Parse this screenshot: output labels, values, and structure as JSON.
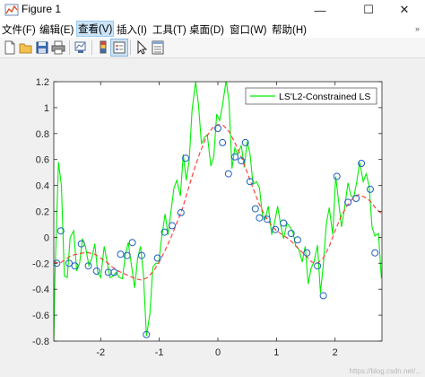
{
  "window": {
    "title": "Figure 1",
    "minimize": "—",
    "maximize": "☐",
    "close": "✕"
  },
  "menu": {
    "items": [
      "文件(F)",
      "编辑(E)",
      "查看(V)",
      "插入(I)",
      "工具(T)",
      "桌面(D)",
      "窗口(W)",
      "帮助(H)"
    ],
    "active_index": 2,
    "overflow": "»"
  },
  "toolbar": {
    "buttons": [
      "new-figure-icon",
      "open-file-icon",
      "save-icon",
      "print-icon",
      "link-plot-icon",
      "insert-colorbar-icon",
      "insert-legend-icon",
      "edit-plot-icon",
      "property-inspector-icon"
    ]
  },
  "watermark": "https://blog.csdn.net/...",
  "chart_data": {
    "type": "line",
    "xlim": [
      -2.8,
      2.8
    ],
    "ylim": [
      -0.8,
      1.2
    ],
    "xticks": [
      -2,
      -1,
      0,
      1,
      2
    ],
    "yticks": [
      -0.8,
      -0.6,
      -0.4,
      -0.2,
      0,
      0.2,
      0.4,
      0.6,
      0.8,
      1,
      1.2
    ],
    "xtick_labels": [
      "-2",
      "-1",
      "0",
      "1",
      "2"
    ],
    "ytick_labels": [
      "-0.8",
      "-0.6",
      "-0.4",
      "-0.2",
      "0",
      "0.2",
      "0.4",
      "0.6",
      "0.8",
      "1",
      "1.2"
    ],
    "grid": false,
    "legend": {
      "location": "top-right",
      "entries": [
        "LS'L2-Constrained LS"
      ]
    },
    "colors": {
      "green": "#00ee00",
      "red": "#ff3333",
      "marker": "#1f5fbf"
    },
    "series": [
      {
        "name": "LS'L2-Constrained LS",
        "style": "solid",
        "color": "#00ee00",
        "x": [
          -2.8,
          -2.78,
          -2.72,
          -2.67,
          -2.62,
          -2.57,
          -2.52,
          -2.46,
          -2.41,
          -2.36,
          -2.31,
          -2.26,
          -2.2,
          -2.15,
          -2.1,
          -2.05,
          -2.0,
          -1.94,
          -1.89,
          -1.84,
          -1.79,
          -1.74,
          -1.68,
          -1.63,
          -1.58,
          -1.53,
          -1.48,
          -1.42,
          -1.37,
          -1.32,
          -1.27,
          -1.22,
          -1.16,
          -1.11,
          -1.06,
          -1.01,
          -0.96,
          -0.9,
          -0.85,
          -0.8,
          -0.75,
          -0.7,
          -0.64,
          -0.59,
          -0.54,
          -0.49,
          -0.44,
          -0.38,
          -0.33,
          -0.28,
          -0.23,
          -0.18,
          -0.12,
          -0.07,
          -0.02,
          0.03,
          0.08,
          0.14,
          0.19,
          0.24,
          0.29,
          0.34,
          0.4,
          0.45,
          0.5,
          0.55,
          0.6,
          0.66,
          0.71,
          0.76,
          0.81,
          0.86,
          0.92,
          0.97,
          1.02,
          1.07,
          1.12,
          1.18,
          1.23,
          1.28,
          1.33,
          1.38,
          1.44,
          1.49,
          1.54,
          1.59,
          1.64,
          1.7,
          1.75,
          1.8,
          1.85,
          1.9,
          1.96,
          2.01,
          2.06,
          2.11,
          2.16,
          2.22,
          2.27,
          2.32,
          2.37,
          2.42,
          2.48,
          2.53,
          2.58,
          2.63,
          2.68,
          2.74,
          2.79,
          2.8
        ],
        "y": [
          -0.8,
          -0.3,
          0.58,
          0.4,
          -0.3,
          -0.31,
          0.0,
          0.05,
          -0.26,
          -0.2,
          -0.01,
          -0.07,
          -0.22,
          -0.16,
          -0.05,
          -0.27,
          -0.31,
          -0.07,
          -0.19,
          -0.31,
          -0.3,
          -0.27,
          -0.31,
          -0.32,
          -0.14,
          -0.04,
          -0.2,
          -0.39,
          -0.16,
          -0.07,
          -0.29,
          -0.76,
          -0.59,
          -0.23,
          -0.2,
          -0.2,
          0.0,
          0.18,
          0.02,
          0.2,
          0.38,
          0.44,
          0.32,
          0.64,
          0.44,
          0.59,
          0.98,
          1.2,
          1.02,
          0.72,
          0.77,
          0.79,
          0.55,
          0.62,
          0.95,
          0.9,
          1.02,
          1.21,
          1.05,
          0.53,
          0.69,
          0.64,
          0.71,
          0.54,
          0.74,
          0.64,
          0.41,
          0.43,
          0.38,
          0.17,
          0.14,
          0.24,
          0.02,
          0.12,
          0.24,
          0.1,
          -0.01,
          0.11,
          0.08,
          0.04,
          -0.07,
          -0.09,
          -0.19,
          -0.07,
          -0.36,
          -0.24,
          -0.19,
          -0.06,
          -0.43,
          -0.21,
          0.1,
          0.23,
          0.02,
          0.47,
          0.28,
          0.08,
          0.22,
          0.42,
          0.32,
          0.31,
          0.43,
          0.58,
          0.43,
          0.49,
          0.4,
          0.08,
          0.01,
          0.03,
          -0.31,
          -0.31
        ]
      },
      {
        "name": "",
        "style": "dashed",
        "color": "#ff3333",
        "x": [
          -2.8,
          -2.7,
          -2.6,
          -2.5,
          -2.4,
          -2.3,
          -2.2,
          -2.1,
          -2.0,
          -1.9,
          -1.8,
          -1.7,
          -1.6,
          -1.5,
          -1.4,
          -1.3,
          -1.2,
          -1.1,
          -1.0,
          -0.9,
          -0.8,
          -0.7,
          -0.6,
          -0.5,
          -0.4,
          -0.3,
          -0.2,
          -0.1,
          0.0,
          0.1,
          0.2,
          0.3,
          0.4,
          0.5,
          0.6,
          0.7,
          0.8,
          0.9,
          1.0,
          1.1,
          1.2,
          1.3,
          1.4,
          1.5,
          1.6,
          1.7,
          1.8,
          1.9,
          2.0,
          2.1,
          2.2,
          2.3,
          2.4,
          2.5,
          2.6,
          2.7,
          2.8
        ],
        "y": [
          -0.19,
          -0.2,
          -0.17,
          -0.14,
          -0.13,
          -0.12,
          -0.12,
          -0.13,
          -0.16,
          -0.19,
          -0.23,
          -0.26,
          -0.28,
          -0.3,
          -0.32,
          -0.33,
          -0.31,
          -0.26,
          -0.19,
          -0.1,
          0.0,
          0.11,
          0.23,
          0.38,
          0.53,
          0.66,
          0.77,
          0.84,
          0.87,
          0.86,
          0.81,
          0.72,
          0.62,
          0.5,
          0.38,
          0.26,
          0.17,
          0.1,
          0.05,
          0.02,
          -0.01,
          -0.05,
          -0.1,
          -0.14,
          -0.19,
          -0.2,
          -0.16,
          -0.07,
          0.05,
          0.16,
          0.24,
          0.3,
          0.33,
          0.31,
          0.28,
          0.22,
          0.18
        ]
      },
      {
        "name": "",
        "style": "markers",
        "color": "#1f5fbf",
        "x": [
          -2.75,
          -2.68,
          -2.54,
          -2.44,
          -2.33,
          -2.21,
          -2.07,
          -1.87,
          -1.77,
          -1.66,
          -1.55,
          -1.46,
          -1.3,
          -1.22,
          -1.03,
          -0.91,
          -0.78,
          -0.63,
          -0.55,
          0.0,
          0.08,
          0.18,
          0.29,
          0.4,
          0.47,
          0.55,
          0.64,
          0.71,
          0.84,
          0.98,
          1.12,
          1.25,
          1.36,
          1.52,
          1.7,
          1.8,
          2.03,
          2.22,
          2.36,
          2.45,
          2.6,
          2.68
        ],
        "y": [
          -0.2,
          0.05,
          -0.2,
          -0.22,
          -0.05,
          -0.22,
          -0.26,
          -0.27,
          -0.27,
          -0.13,
          -0.14,
          -0.04,
          -0.14,
          -0.75,
          -0.16,
          0.04,
          0.09,
          0.19,
          0.61,
          0.84,
          0.73,
          0.49,
          0.62,
          0.59,
          0.73,
          0.43,
          0.22,
          0.15,
          0.14,
          0.06,
          0.11,
          0.03,
          -0.02,
          -0.12,
          -0.22,
          -0.45,
          0.47,
          0.27,
          0.3,
          0.57,
          0.37,
          -0.12
        ]
      }
    ]
  }
}
